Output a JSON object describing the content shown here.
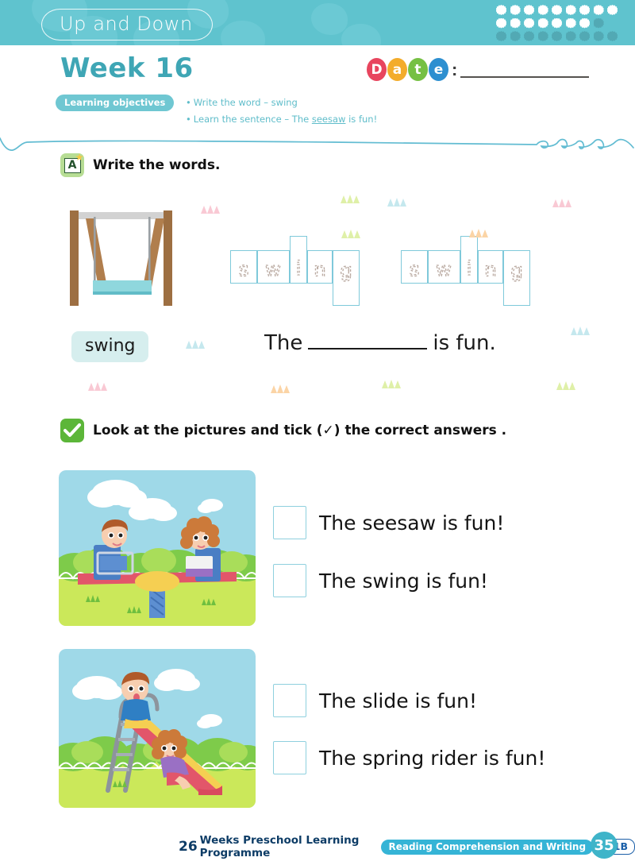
{
  "header": {
    "banner_title": "Up and Down",
    "banner_color": "#5fc3ce",
    "dot_rows": [
      {
        "count": 9,
        "style": "white"
      },
      {
        "count": 8,
        "style": "white-with-dim-last"
      },
      {
        "count": 9,
        "style": "dim"
      }
    ]
  },
  "week": {
    "title": "Week 16",
    "color": "#3fa6b5"
  },
  "objectives": {
    "chip_label": "Learning objectives",
    "items": [
      {
        "bullet": "•",
        "text": "Write the word – swing"
      },
      {
        "bullet": "•",
        "text_before": "Learn the sentence – The ",
        "underlined": "seesaw",
        "text_after": " is fun!"
      }
    ]
  },
  "date": {
    "letters": [
      {
        "char": "D",
        "color": "#e8455e"
      },
      {
        "char": "a",
        "color": "#f3ac2b"
      },
      {
        "char": "t",
        "color": "#76c043"
      },
      {
        "char": "e",
        "color": "#2d8fd0"
      }
    ],
    "colon": ":",
    "value": ""
  },
  "section_a": {
    "icon": "letter-a-card-icon",
    "icon_letter": "A",
    "heading": "Write the words.",
    "picture": "swing-illustration",
    "trace_word": "swing",
    "trace_letters": [
      "s",
      "w",
      "i",
      "n",
      "g"
    ],
    "trace_repeats": 2,
    "word_chip": "swing",
    "sentence_before": "The",
    "sentence_blank": "",
    "sentence_after": "is fun."
  },
  "section_b": {
    "icon": "green-check-icon",
    "heading": "Look at the pictures and tick (✓) the correct answers .",
    "questions": [
      {
        "picture": "seesaw-with-two-children",
        "options": [
          {
            "label": "The seesaw is fun!",
            "checked": false
          },
          {
            "label": "The swing is fun!",
            "checked": false
          }
        ]
      },
      {
        "picture": "slide-with-two-children",
        "options": [
          {
            "label": "The slide is fun!",
            "checked": false
          },
          {
            "label": "The spring rider is fun!",
            "checked": false
          }
        ]
      }
    ]
  },
  "footer": {
    "number": "26",
    "programme": "Weeks Preschool Learning Programme",
    "subject_pill": "Reading Comprehension and Writing",
    "level": "K1B",
    "page": "35"
  },
  "decor": {
    "triangle_colors": [
      "#f9c9d4",
      "#dff0a8",
      "#fbd4a6",
      "#c5e8ee"
    ]
  }
}
